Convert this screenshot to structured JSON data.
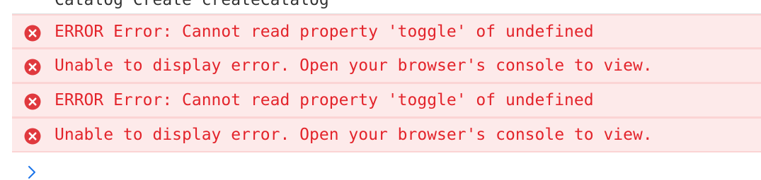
{
  "console": {
    "previous_line": "Catalog Create createCatalog",
    "messages": [
      {
        "level": "error",
        "icon": "error-icon",
        "text": "ERROR Error: Cannot read property 'toggle' of undefined"
      },
      {
        "level": "error",
        "icon": "error-icon",
        "text": "Unable to display error. Open your browser's console to view."
      },
      {
        "level": "error",
        "icon": "error-icon",
        "text": "ERROR Error: Cannot read property 'toggle' of undefined"
      },
      {
        "level": "error",
        "icon": "error-icon",
        "text": "Unable to display error. Open your browser's console to view."
      }
    ],
    "prompt_icon": "chevron-right-icon"
  },
  "colors": {
    "error_text": "#e3242b",
    "error_background": "#fdeaea",
    "error_border": "#fbd4d4",
    "error_icon": "#e0393e",
    "prompt_chevron": "#1a73e8"
  }
}
